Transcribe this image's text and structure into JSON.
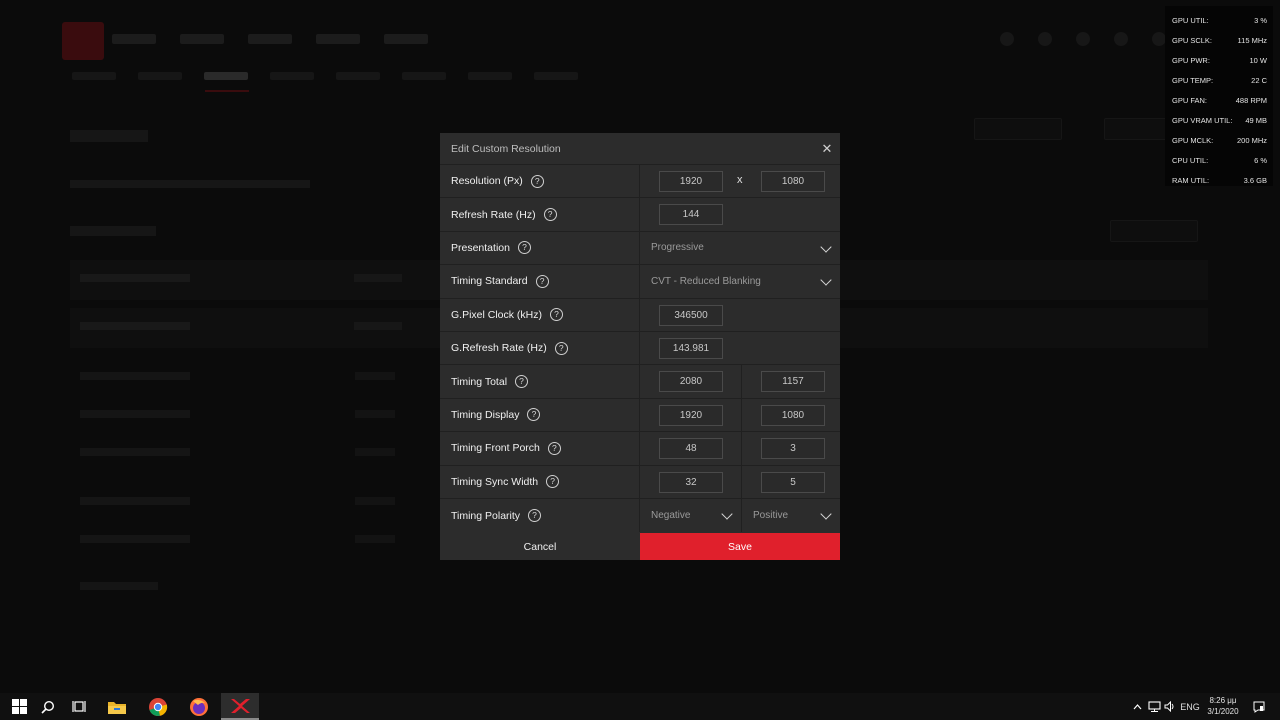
{
  "overlay": [
    {
      "label": "GPU UTIL:",
      "value": "3 %"
    },
    {
      "label": "GPU SCLK:",
      "value": "115 MHz"
    },
    {
      "label": "GPU PWR:",
      "value": "10 W"
    },
    {
      "label": "GPU TEMP:",
      "value": "22 C"
    },
    {
      "label": "GPU FAN:",
      "value": "488 RPM"
    },
    {
      "label": "GPU VRAM UTIL:",
      "value": "49 MB"
    },
    {
      "label": "GPU MCLK:",
      "value": "200 MHz"
    },
    {
      "label": "CPU UTIL:",
      "value": "6 %"
    },
    {
      "label": "RAM UTIL:",
      "value": "3.6 GB"
    }
  ],
  "modal": {
    "title": "Edit Custom Resolution",
    "close_glyph": "✕",
    "help_glyph": "?",
    "separator": "x",
    "rows": {
      "resolution": {
        "label": "Resolution (Px)",
        "a": "1920",
        "b": "1080"
      },
      "refresh_rate": {
        "label": "Refresh Rate (Hz)",
        "a": "144"
      },
      "presentation": {
        "label": "Presentation",
        "value": "Progressive"
      },
      "timing_standard": {
        "label": "Timing Standard",
        "value": "CVT - Reduced Blanking"
      },
      "pixel_clock": {
        "label": "G.Pixel Clock (kHz)",
        "a": "346500"
      },
      "g_refresh_rate": {
        "label": "G.Refresh Rate (Hz)",
        "a": "143.981"
      },
      "timing_total": {
        "label": "Timing Total",
        "a": "2080",
        "b": "1157"
      },
      "timing_display": {
        "label": "Timing Display",
        "a": "1920",
        "b": "1080"
      },
      "front_porch": {
        "label": "Timing Front Porch",
        "a": "48",
        "b": "3"
      },
      "sync_width": {
        "label": "Timing Sync Width",
        "a": "32",
        "b": "5"
      },
      "polarity": {
        "label": "Timing Polarity",
        "a": "Negative",
        "b": "Positive"
      }
    },
    "cancel_label": "Cancel",
    "save_label": "Save"
  },
  "taskbar": {
    "language": "ENG",
    "time": "8:26 μμ",
    "date": "3/1/2020"
  },
  "colors": {
    "accent": "#e0202c",
    "modal_bg": "#2c2c2c",
    "background": "#070707"
  }
}
